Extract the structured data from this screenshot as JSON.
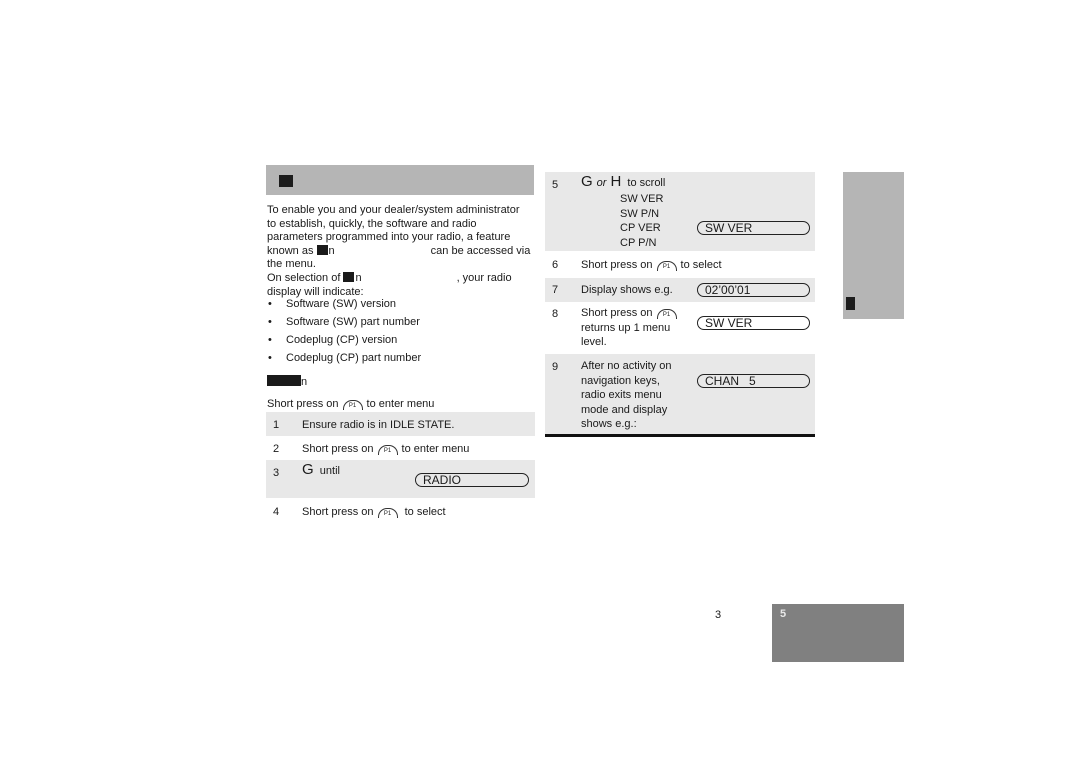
{
  "left": {
    "section_header_glyph": "■",
    "intro_lines": {
      "l1": "To enable you and your dealer/system administrator",
      "l2": "to establish, quickly, the software and radio",
      "l3": "parameters programmed into your radio, a feature",
      "l4a": "known as",
      "l4b": "can be accessed via",
      "l5": "the menu.",
      "l6a": "On selection of",
      "l6b": ", your radio",
      "l7": "display will indicate:"
    },
    "bullets": [
      "Software (SW) version",
      "Software (SW) part number",
      "Codeplug (CP) version",
      "Codeplug (CP) part number"
    ],
    "bullet_char": "•",
    "pre_steps": {
      "a": "Short press on",
      "b": "to enter menu"
    },
    "p1_key": "P1",
    "steps": [
      {
        "num": "1",
        "text": "Ensure radio is in IDLE STATE."
      },
      {
        "num": "2",
        "a": "Short press on",
        "b": "to enter menu"
      },
      {
        "num": "3",
        "key": "G",
        "text": "until",
        "display": "RADIO"
      },
      {
        "num": "4",
        "a": "Short press on",
        "b": "to select"
      }
    ]
  },
  "right": {
    "steps": [
      {
        "num": "5",
        "key1": "G",
        "or": "or",
        "key2": "H",
        "text": "to scroll",
        "options": [
          "SW VER",
          "SW P/N",
          "CP VER",
          "CP P/N"
        ],
        "display": "SW VER"
      },
      {
        "num": "6",
        "a": "Short press on",
        "b": "to select"
      },
      {
        "num": "7",
        "text": "Display shows e.g.",
        "display": "02’00’01"
      },
      {
        "num": "8",
        "l1": "Short press on",
        "l2": "returns up 1 menu",
        "l3": "level.",
        "display": "SW VER"
      },
      {
        "num": "9",
        "lines": [
          "After no activity on",
          "navigation keys,",
          "radio exits menu",
          "mode and display",
          "shows e.g.:"
        ],
        "display": "CHAN   5"
      }
    ]
  },
  "footer": {
    "page_number": "3",
    "tab_glyph": "5"
  }
}
